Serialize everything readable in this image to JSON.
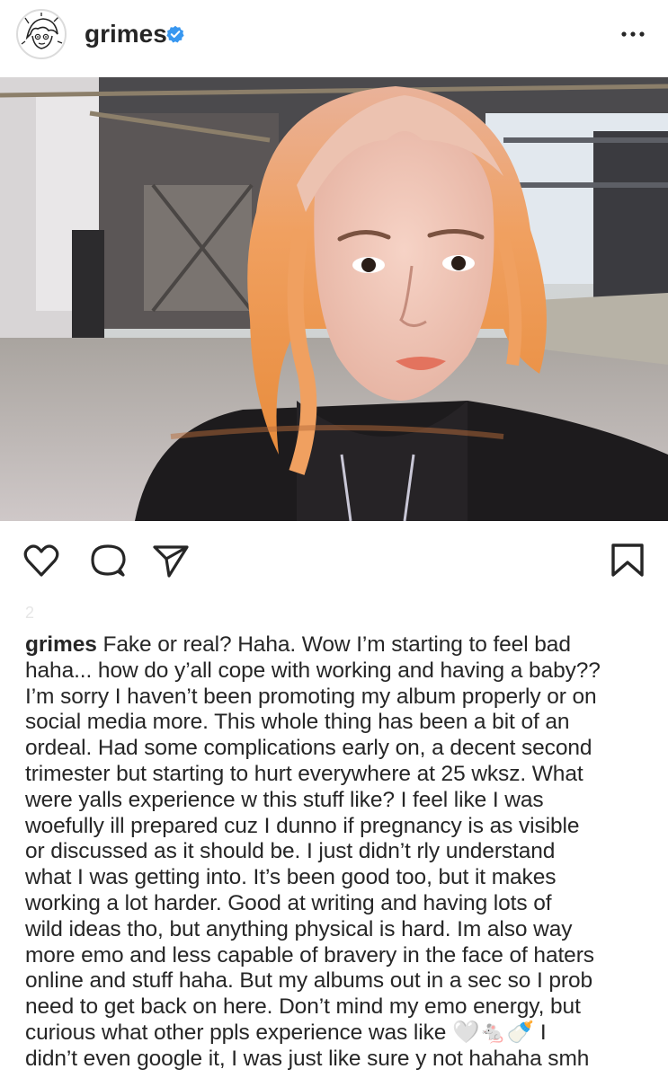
{
  "header": {
    "username": "grimes",
    "more_label": "•••",
    "verified_color": "#3897f0"
  },
  "photo": {
    "subject": "selfie with orange hair in abandoned industrial building"
  },
  "actions": {
    "icons": [
      "heart-icon",
      "comment-icon",
      "share-icon",
      "bookmark-icon"
    ]
  },
  "post": {
    "date_faded": "2"
  },
  "caption": {
    "username": "grimes",
    "lines": [
      " Fake or real?  Haha.  Wow I’m starting to feel bad",
      "haha... how do y’all cope with working and having a baby??",
      "I’m sorry I haven’t been promoting my album properly or on",
      "social media more.  This whole thing has been a bit of an",
      "ordeal.  Had some complications early on, a decent second",
      "trimester but starting to hurt everywhere at 25 wksz.  What",
      "were yalls experience w this stuff like?  I feel like I was",
      "woefully ill prepared cuz I dunno if pregnancy is as visible",
      "or discussed as it should be.  I just didn’t rly understand",
      "what I was getting into.  It’s been good too, but it makes",
      "working a lot harder.  Good at writing and having lots of",
      "wild ideas tho, but anything physical is hard.  Im also way",
      "more emo and less capable of bravery in the face of haters",
      "online and stuff haha.  But my albums out in a sec so I prob",
      "need to get back on here.  Don’t mind my emo energy, but",
      "curious what other ppls experience was like 🤍🐁🍼 I",
      "didn’t even google it,  I was just like sure y not hahaha  smh"
    ]
  }
}
